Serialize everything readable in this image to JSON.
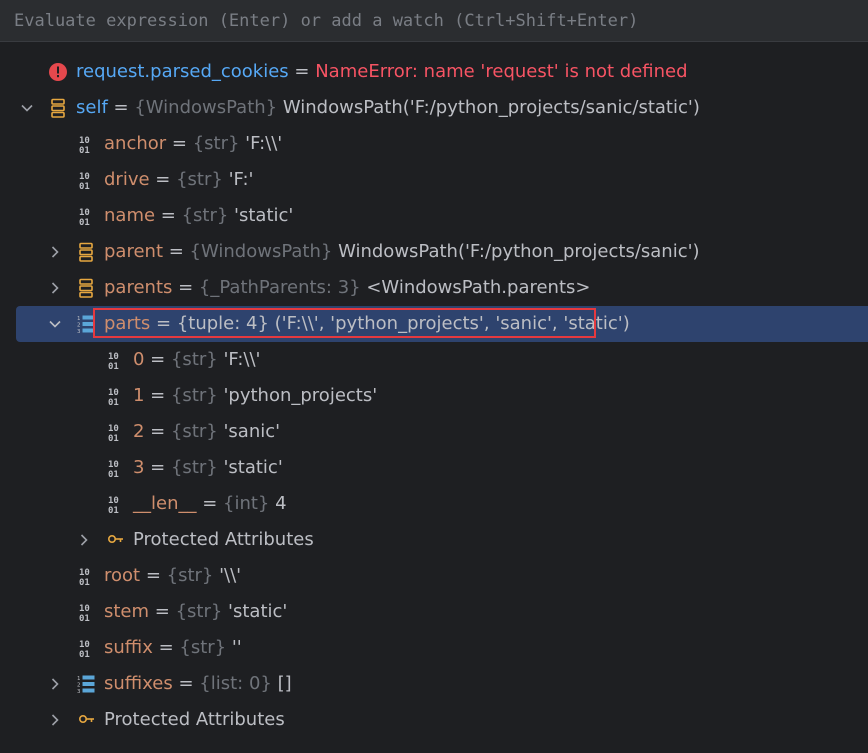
{
  "eval": {
    "placeholder": "Evaluate expression (Enter) or add a watch (Ctrl+Shift+Enter)"
  },
  "icons": {
    "error": "error-icon",
    "object": "object-icon",
    "primitive": "primitive-icon",
    "list": "list-icon",
    "key": "key-icon",
    "chevron_down": "chevron-down-icon",
    "chevron_right": "chevron-right-icon"
  },
  "colors": {
    "selection": "#2e436e",
    "highlight_border": "#e5393f",
    "error": "#f75464",
    "name_blue": "#56a8f5",
    "name_orange": "#cf8e6d"
  },
  "rows": [
    {
      "name": "request.parsed_cookies",
      "sep": " = ",
      "value": "NameError: name 'request' is not defined"
    },
    {
      "name": "self",
      "sep": " = ",
      "type": "{WindowsPath}",
      "value": " WindowsPath('F:/python_projects/sanic/static')"
    },
    {
      "name": "anchor",
      "sep": " = ",
      "type": "{str}",
      "value": " 'F:\\\\'"
    },
    {
      "name": "drive",
      "sep": " = ",
      "type": "{str}",
      "value": " 'F:'"
    },
    {
      "name": "name",
      "sep": " = ",
      "type": "{str}",
      "value": " 'static'"
    },
    {
      "name": "parent",
      "sep": " = ",
      "type": "{WindowsPath}",
      "value": " WindowsPath('F:/python_projects/sanic')"
    },
    {
      "name": "parents",
      "sep": " = ",
      "type": "{_PathParents: 3}",
      "value": " <WindowsPath.parents>"
    },
    {
      "name": "parts",
      "sep": " = ",
      "type": "{tuple: 4}",
      "value": " ('F:\\\\', 'python_projects', 'sanic', 'static')"
    },
    {
      "name": "0",
      "sep": " = ",
      "type": "{str}",
      "value": " 'F:\\\\'"
    },
    {
      "name": "1",
      "sep": " = ",
      "type": "{str}",
      "value": " 'python_projects'"
    },
    {
      "name": "2",
      "sep": " = ",
      "type": "{str}",
      "value": " 'sanic'"
    },
    {
      "name": "3",
      "sep": " = ",
      "type": "{str}",
      "value": " 'static'"
    },
    {
      "name": "__len__",
      "sep": " = ",
      "type": "{int}",
      "value": " 4"
    },
    {
      "label": "Protected Attributes"
    },
    {
      "name": "root",
      "sep": " = ",
      "type": "{str}",
      "value": " '\\\\'"
    },
    {
      "name": "stem",
      "sep": " = ",
      "type": "{str}",
      "value": " 'static'"
    },
    {
      "name": "suffix",
      "sep": " = ",
      "type": "{str}",
      "value": " ''"
    },
    {
      "name": "suffixes",
      "sep": " = ",
      "type": "{list: 0}",
      "value": " []"
    },
    {
      "label": "Protected Attributes"
    }
  ]
}
